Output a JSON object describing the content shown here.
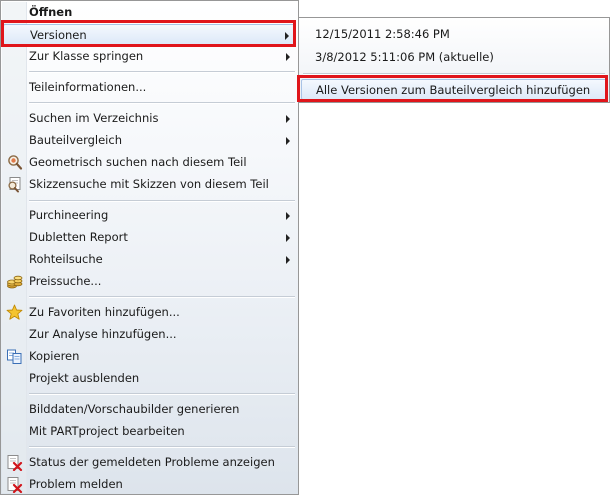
{
  "menu": {
    "items": [
      {
        "label": "Öffnen"
      },
      {
        "label": "Versionen"
      },
      {
        "label": "Zur Klasse springen"
      },
      {
        "label": "Teileinformationen..."
      },
      {
        "label": "Suchen im Verzeichnis"
      },
      {
        "label": "Bauteilvergleich"
      },
      {
        "label": "Geometrisch suchen nach diesem Teil"
      },
      {
        "label": "Skizzensuche mit Skizzen von diesem Teil"
      },
      {
        "label": "Purchineering"
      },
      {
        "label": "Dubletten Report"
      },
      {
        "label": "Rohteilsuche"
      },
      {
        "label": "Preissuche..."
      },
      {
        "label": "Zu Favoriten hinzufügen..."
      },
      {
        "label": "Zur Analyse hinzufügen..."
      },
      {
        "label": "Kopieren"
      },
      {
        "label": "Projekt ausblenden"
      },
      {
        "label": "Bilddaten/Vorschaubilder generieren"
      },
      {
        "label": "Mit PARTproject bearbeiten"
      },
      {
        "label": "Status der gemeldeten Probleme anzeigen"
      },
      {
        "label": "Problem melden"
      }
    ]
  },
  "submenu": {
    "items": [
      {
        "label": "12/15/2011 2:58:46 PM"
      },
      {
        "label": "3/8/2012 5:11:06 PM (aktuelle)"
      },
      {
        "label": "Alle Versionen zum Bauteilvergleich hinzufügen"
      }
    ]
  },
  "colors": {
    "highlight_frame": "#e0151b",
    "hover_fill": "#dde9f8",
    "menu_border": "#979797"
  }
}
